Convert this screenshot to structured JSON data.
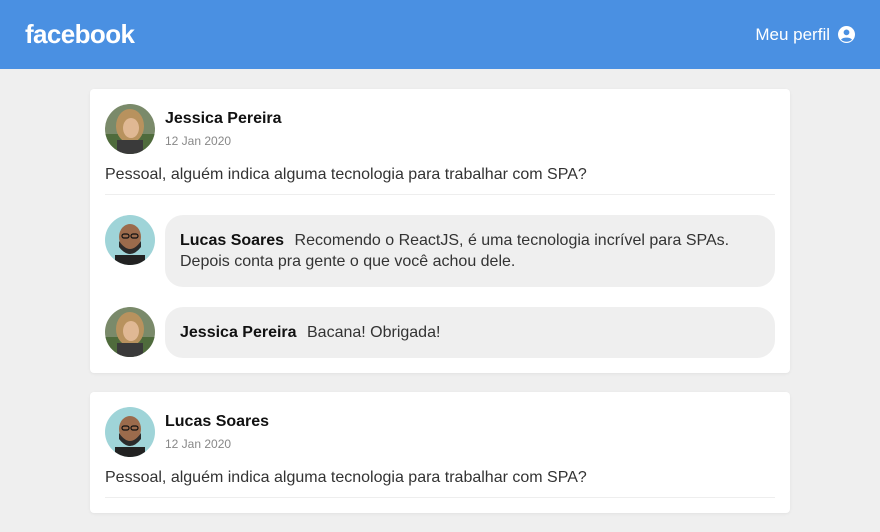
{
  "header": {
    "logo": "facebook",
    "profile_label": "Meu perfil"
  },
  "posts": [
    {
      "author": "Jessica Pereira",
      "date": "12 Jan 2020",
      "content": "Pessoal, alguém indica alguma tecnologia para trabalhar com SPA?",
      "comments": [
        {
          "author": "Lucas Soares",
          "text": "Recomendo o ReactJS, é uma tecnologia incrível para SPAs. Depois conta pra gente o que você achou dele."
        },
        {
          "author": "Jessica Pereira",
          "text": "Bacana! Obrigada!"
        }
      ]
    },
    {
      "author": "Lucas Soares",
      "date": "12 Jan 2020",
      "content": "Pessoal, alguém indica alguma tecnologia para trabalhar com SPA?"
    }
  ],
  "colors": {
    "header": "#4a90e2",
    "background": "#efefef",
    "bubble": "#efefef"
  }
}
